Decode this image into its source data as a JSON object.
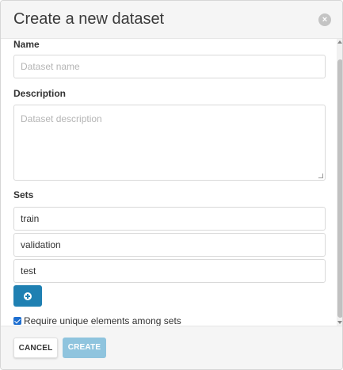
{
  "dialog": {
    "title": "Create a new dataset",
    "close_icon": "close-circle-icon",
    "close_glyph": "×"
  },
  "form": {
    "name": {
      "label": "Name",
      "placeholder": "Dataset name",
      "value": ""
    },
    "description": {
      "label": "Description",
      "placeholder": "Dataset description",
      "value": ""
    },
    "sets": {
      "label": "Sets",
      "items": [
        {
          "value": "train"
        },
        {
          "value": "validation"
        },
        {
          "value": "test"
        }
      ],
      "add_icon": "plus-circle-icon"
    },
    "unique_checkbox": {
      "label": "Require unique elements among sets",
      "checked": true
    }
  },
  "footer": {
    "cancel_label": "CANCEL",
    "create_label": "CREATE"
  },
  "colors": {
    "primary": "#1f80b2",
    "primary_disabled": "#8fc4de",
    "header_bg": "#f5f5f5"
  }
}
